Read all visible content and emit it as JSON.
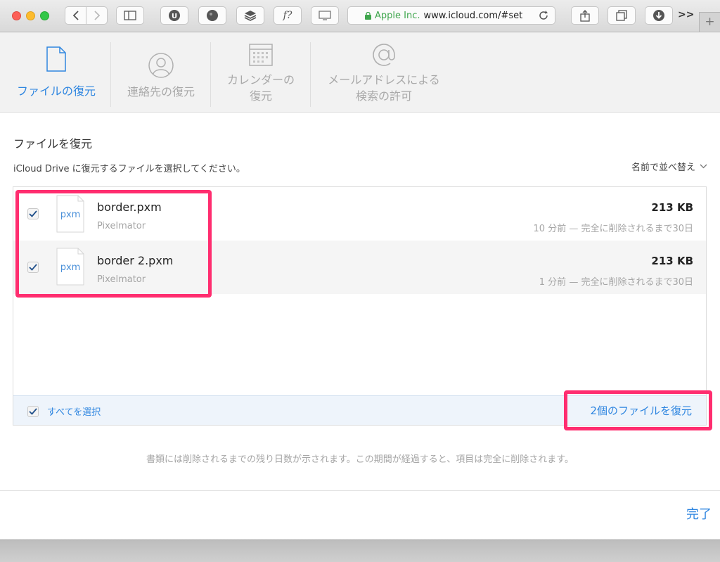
{
  "browser": {
    "url_org": "Apple Inc.",
    "url_text": "www.icloud.com/#set",
    "overflow_label": ">>",
    "new_tab_label": "+",
    "extension_f_label": "f?"
  },
  "tabs": [
    {
      "label_lines": [
        "ファイルの復元"
      ],
      "icon": "document-icon",
      "active": true
    },
    {
      "label_lines": [
        "連絡先の復元"
      ],
      "icon": "contact-icon",
      "active": false
    },
    {
      "label_lines": [
        "カレンダーの",
        "復元"
      ],
      "icon": "calendar-icon",
      "active": false
    },
    {
      "label_lines": [
        "メールアドレスによる",
        "検索の許可"
      ],
      "icon": "at-sign-icon",
      "active": false
    }
  ],
  "section": {
    "title": "ファイルを復元",
    "description": "iCloud Drive に復元するファイルを選択してください。",
    "sort_label": "名前で並べ替え"
  },
  "files": [
    {
      "name": "border.pxm",
      "app": "Pixelmator",
      "icon_text": "pxm",
      "size": "213 KB",
      "deletion": "10 分前 — 完全に削除されるまで30日",
      "checked": true
    },
    {
      "name": "border 2.pxm",
      "app": "Pixelmator",
      "icon_text": "pxm",
      "size": "213 KB",
      "deletion": "1 分前 — 完全に削除されるまで30日",
      "checked": true
    }
  ],
  "footer": {
    "select_all_label": "すべてを選択",
    "restore_label": "2個のファイルを復元"
  },
  "note": "書類には削除されるまでの残り日数が示されます。この期間が経過すると、項目は完全に削除されます。",
  "done_label": "完了",
  "colors": {
    "accent": "#2f86e0",
    "highlight": "#ff2d6f",
    "secure_green": "#3fa64d"
  }
}
